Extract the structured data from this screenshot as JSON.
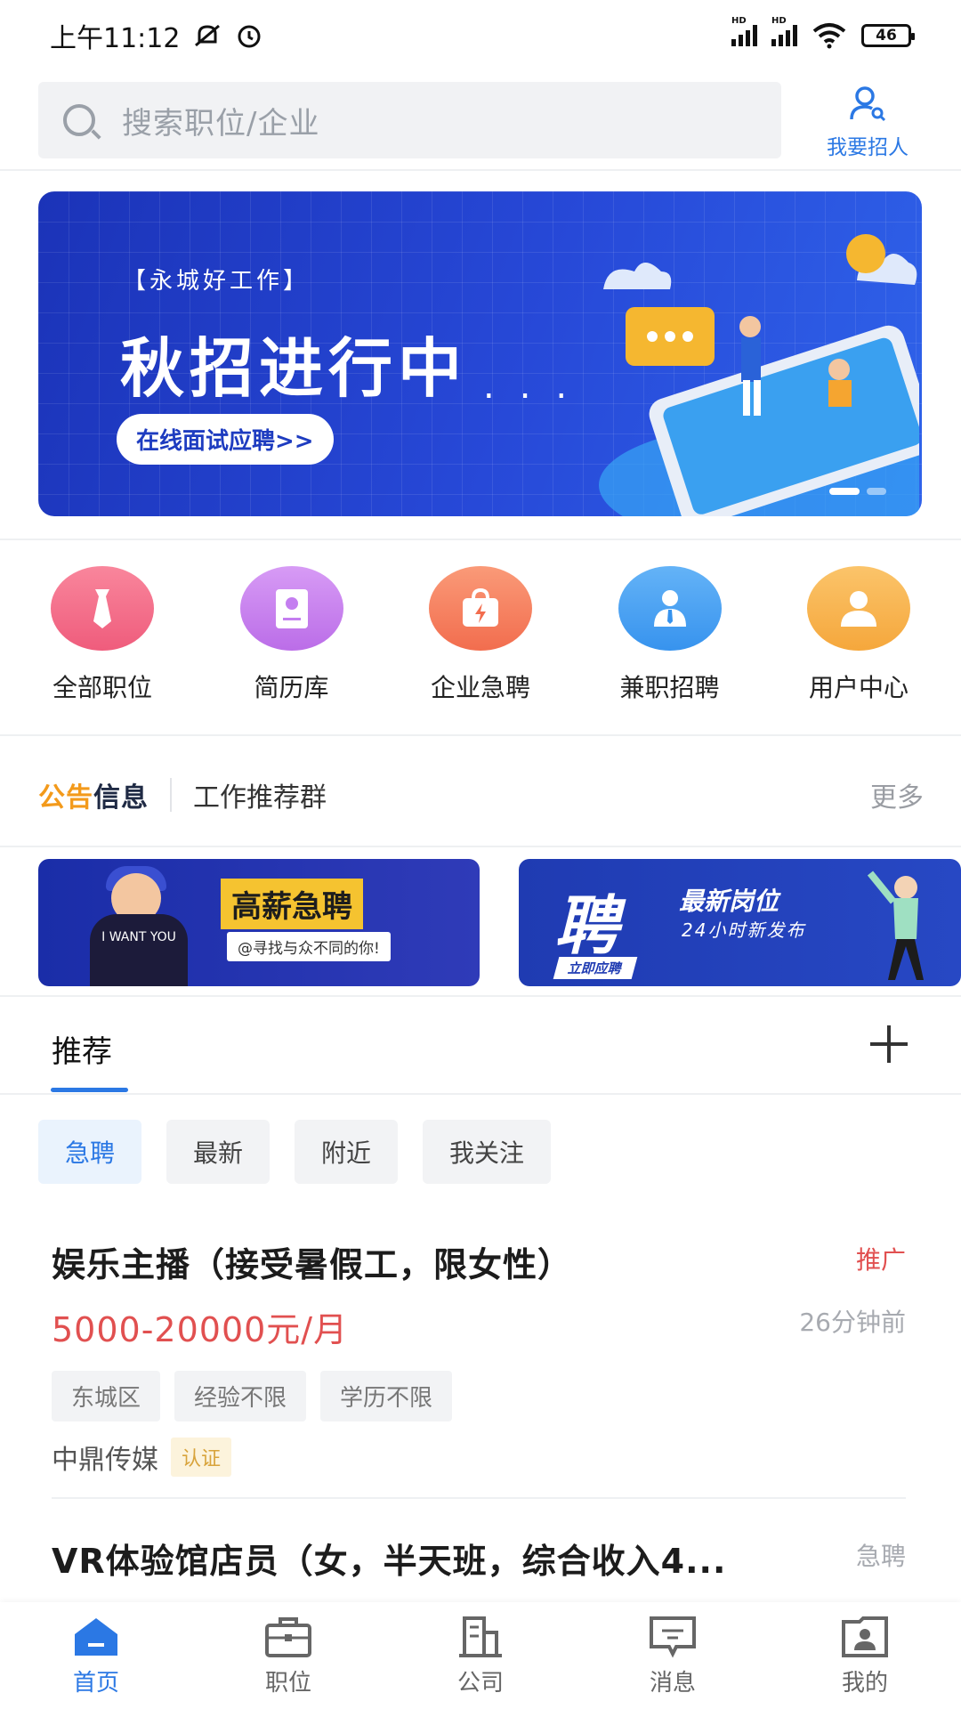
{
  "status_bar": {
    "time": "上午11:12",
    "battery": "46"
  },
  "search": {
    "placeholder": "搜索职位/企业"
  },
  "recruit": {
    "label": "我要招人"
  },
  "banner": {
    "subtitle": "【永城好工作】",
    "title": "秋招进行中",
    "dots": "...",
    "cta": "在线面试应聘>>"
  },
  "quick_nav": [
    {
      "label": "全部职位",
      "icon": "tie-icon",
      "color": "#f06a86"
    },
    {
      "label": "简历库",
      "icon": "resume-icon",
      "color": "#c881f0"
    },
    {
      "label": "企业急聘",
      "icon": "bag-icon",
      "color": "#f5845f"
    },
    {
      "label": "兼职招聘",
      "icon": "person-icon",
      "color": "#4aa3f2"
    },
    {
      "label": "用户中心",
      "icon": "user-icon",
      "color": "#f7b350"
    }
  ],
  "notice": {
    "logo_a": "公告",
    "logo_b": "信息",
    "text": "工作推荐群",
    "more": "更多"
  },
  "promo": {
    "card1": {
      "tag": "高薪急聘",
      "sub": "@寻找与众不同的你!",
      "shirt": "I WANT YOU"
    },
    "card2": {
      "big": "聘",
      "line1": "最新岗位",
      "line2": "24小时新发布",
      "button": "立即应聘"
    }
  },
  "tabs": {
    "active": "推荐"
  },
  "filters": [
    "急聘",
    "最新",
    "附近",
    "我关注"
  ],
  "jobs": [
    {
      "title": "娱乐主播（接受暑假工，限女性）",
      "badge": "推广",
      "salary": "5000-20000元/月",
      "time": "26分钟前",
      "tags": [
        "东城区",
        "经验不限",
        "学历不限"
      ],
      "company": "中鼎传媒",
      "cert": "认证"
    },
    {
      "title": "VR体验馆店员（女，半天班，综合收入4...",
      "badge": "急聘"
    }
  ],
  "colors": {
    "accent": "#2b78e4",
    "salary": "#e15050",
    "promo_badge": "#e15050"
  },
  "bottom_nav": [
    {
      "label": "首页",
      "icon": "home-icon"
    },
    {
      "label": "职位",
      "icon": "briefcase-icon"
    },
    {
      "label": "公司",
      "icon": "building-icon"
    },
    {
      "label": "消息",
      "icon": "message-icon"
    },
    {
      "label": "我的",
      "icon": "profile-icon"
    }
  ]
}
